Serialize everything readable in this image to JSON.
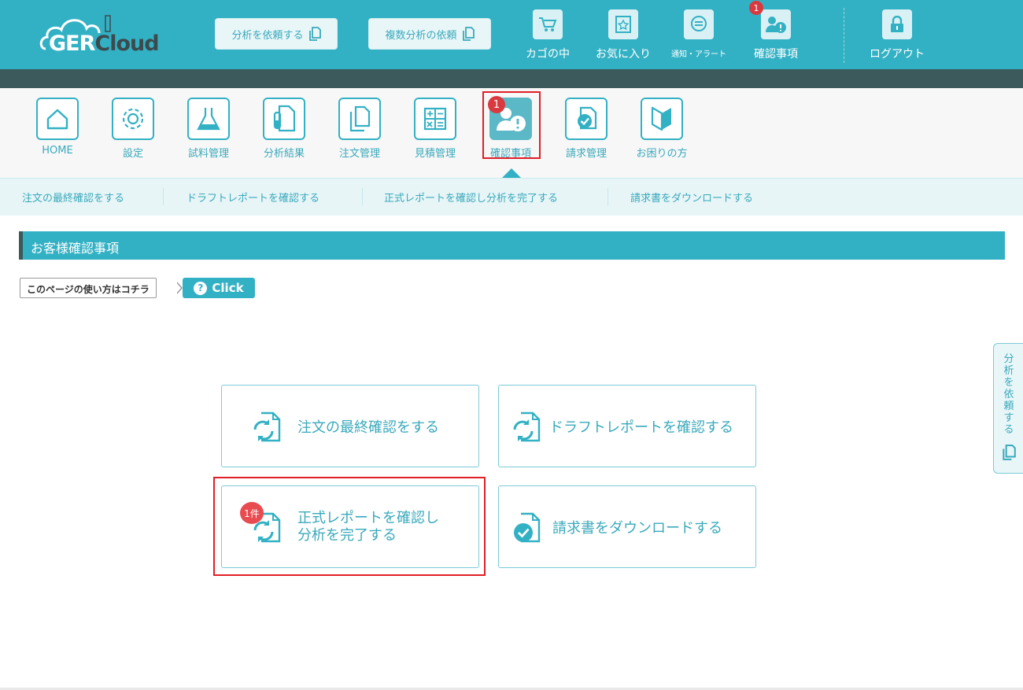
{
  "logo": {
    "part1": "GER",
    "part2": "Cloud"
  },
  "top_buttons": {
    "request_analysis": "分析を依頼する",
    "request_multiple": "複数分析の依頼"
  },
  "top_icons": {
    "cart": "カゴの中",
    "favorites": "お気に入り",
    "notifications": "通知・アラート",
    "confirmations": "確認事項",
    "confirmations_badge": "1",
    "logout": "ログアウト"
  },
  "nav": {
    "items": [
      {
        "label": "HOME",
        "icon": "home-icon"
      },
      {
        "label": "設定",
        "icon": "gear-icon"
      },
      {
        "label": "試料管理",
        "icon": "flask-icon"
      },
      {
        "label": "分析結果",
        "icon": "test-tube-document-icon"
      },
      {
        "label": "注文管理",
        "icon": "copy-documents-icon"
      },
      {
        "label": "見積管理",
        "icon": "calculator-icon"
      },
      {
        "label": "確認事項",
        "icon": "person-alert-icon",
        "active": true
      },
      {
        "label": "請求管理",
        "icon": "check-document-icon"
      },
      {
        "label": "お困りの方",
        "icon": "beginner-mark-icon"
      }
    ],
    "active_badge": "1"
  },
  "subnav": {
    "links": [
      "注文の最終確認をする",
      "ドラフトレポートを確認する",
      "正式レポートを確認し分析を完了する",
      "請求書をダウンロードする"
    ]
  },
  "section": {
    "title": "お客様確認事項"
  },
  "howto": {
    "label": "このページの使い方はコチラ",
    "button": "Click"
  },
  "cards": {
    "order_final": "注文の最終確認をする",
    "draft_report": "ドラフトレポートを確認する",
    "formal_report_line1": "正式レポートを確認し",
    "formal_report_line2": "分析を完了する",
    "formal_report_badge": "1件",
    "invoice": "請求書をダウンロードする"
  },
  "side_tab": {
    "label": "分析を依頼する"
  },
  "colors": {
    "brand": "#33b1c4",
    "dark_band": "#3c5a5c",
    "highlight": "#e01f26",
    "badge": "#d93a3f"
  }
}
